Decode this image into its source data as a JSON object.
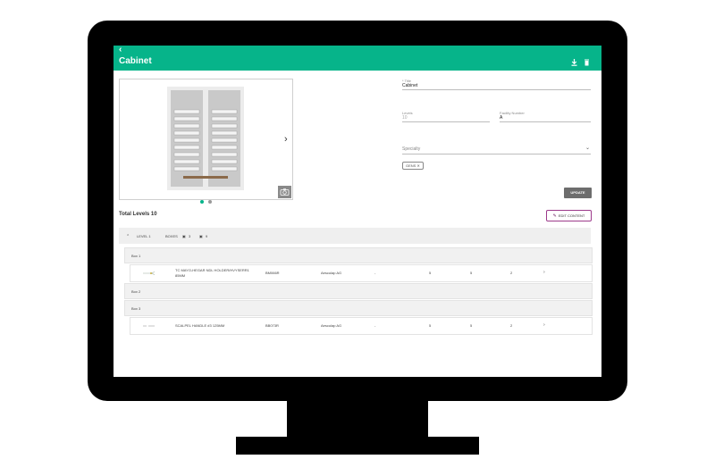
{
  "app": {
    "back_icon": "back-arrow-icon",
    "title": "Cabinet",
    "download_icon": "download-icon",
    "delete_icon": "trash-icon"
  },
  "gallery": {
    "next_icon": "chevron-right-icon",
    "slides": 2,
    "active_slide": 1,
    "camera_icon": "camera-icon"
  },
  "form": {
    "title_label": "* Title",
    "title_value": "Cabinet",
    "levels_label": "Levels",
    "levels_value": "10",
    "facility_label": "Facility Number",
    "facility_value": "A",
    "specialty_label": "Specialty",
    "specialty_chip": "GENS",
    "update_label": "UPDATE"
  },
  "summary": {
    "total_levels": "Total Levels 10",
    "edit_label": "EDIT CONTENT"
  },
  "level": {
    "name": "LEVEL 1",
    "boxes_label": "BOXES",
    "box_count": "3",
    "item_count": "9"
  },
  "boxes": [
    {
      "name": "Box 1"
    },
    {
      "name": "Box 2"
    },
    {
      "name": "Box 3"
    }
  ],
  "items": [
    {
      "desc_line1": "TC MAYO-HEGAR NDL HOLDER/HVYSERR1",
      "desc_line2": "85MM",
      "code": "BM066R",
      "vendor": "Aesculap AG",
      "dash": "-",
      "q1": "5",
      "q2": "5",
      "q3": "2"
    },
    {
      "desc_line1": "SCALPEL HANDLE #3 125MM",
      "code": "BB073R",
      "vendor": "Aesculap AG",
      "dash": "-",
      "q1": "5",
      "q2": "5",
      "q3": "2"
    }
  ],
  "colors": {
    "brand": "#06b48a",
    "accent": "#9c3a8b"
  }
}
